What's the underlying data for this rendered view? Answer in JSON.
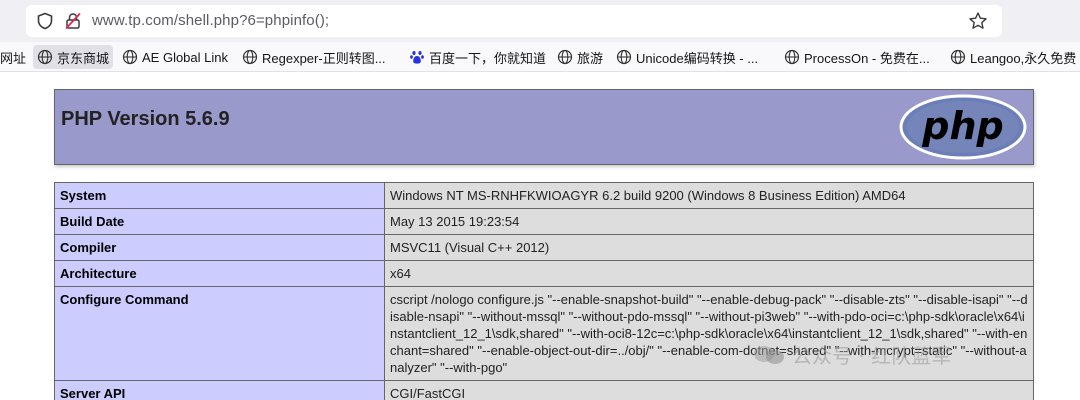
{
  "browser": {
    "url": "www.tp.com/shell.php?6=phpinfo();"
  },
  "bookmarks": [
    {
      "label": "网址"
    },
    {
      "label": "京东商城"
    },
    {
      "label": "AE Global Link"
    },
    {
      "label": "Regexper-正则转图..."
    },
    {
      "label": "百度一下，你就知道"
    },
    {
      "label": "旅游"
    },
    {
      "label": "Unicode编码转换 - ..."
    },
    {
      "label": "ProcessOn - 免费在..."
    },
    {
      "label": "Leangoo,永久免费"
    }
  ],
  "php": {
    "version_title": "PHP Version 5.6.9",
    "logo_text": "php"
  },
  "info_rows": [
    {
      "label": "System",
      "value": "Windows NT MS-RNHFKWIOAGYR 6.2 build 9200 (Windows 8 Business Edition) AMD64"
    },
    {
      "label": "Build Date",
      "value": "May 13 2015 19:23:54"
    },
    {
      "label": "Compiler",
      "value": "MSVC11 (Visual C++ 2012)"
    },
    {
      "label": "Architecture",
      "value": "x64"
    },
    {
      "label": "Configure Command",
      "value": "cscript /nologo configure.js \"--enable-snapshot-build\" \"--enable-debug-pack\" \"--disable-zts\" \"--disable-isapi\" \"--disable-nsapi\" \"--without-mssql\" \"--without-pdo-mssql\" \"--without-pi3web\" \"--with-pdo-oci=c:\\php-sdk\\oracle\\x64\\instantclient_12_1\\sdk,shared\" \"--with-oci8-12c=c:\\php-sdk\\oracle\\x64\\instantclient_12_1\\sdk,shared\" \"--with-enchant=shared\" \"--enable-object-out-dir=../obj/\" \"--enable-com-dotnet=shared\" \"--with-mcrypt=static\" \"--without-analyzer\" \"--with-pgo\""
    },
    {
      "label": "Server API",
      "value": "CGI/FastCGI"
    }
  ],
  "watermark": {
    "text": "公众号 · 红队蓝军"
  }
}
